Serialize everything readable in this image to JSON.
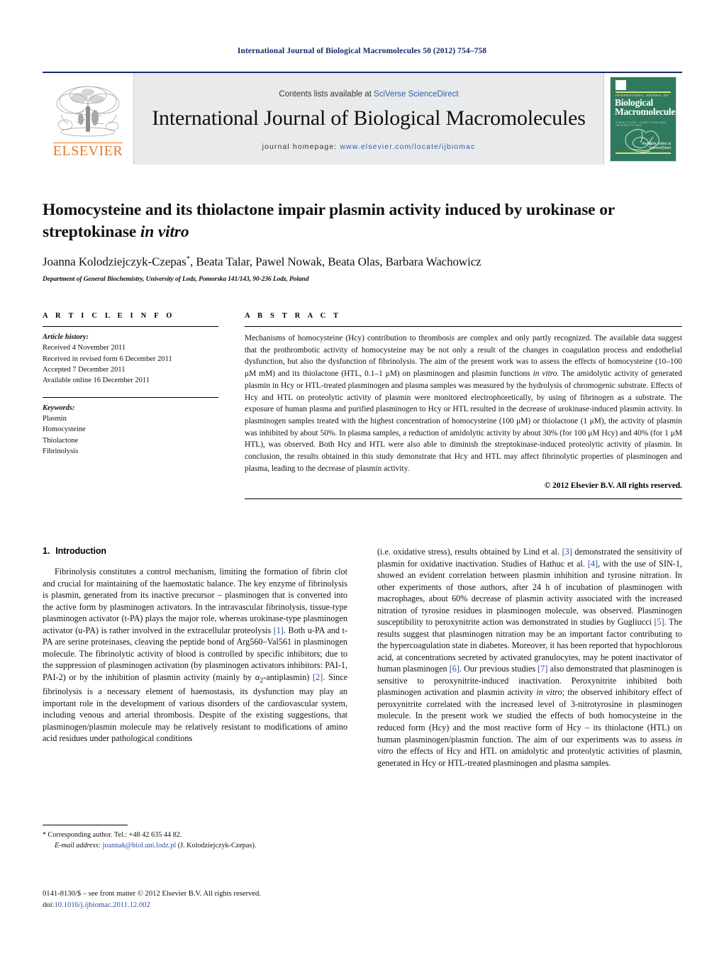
{
  "running_head": "International Journal of Biological Macromolecules 50 (2012) 754–758",
  "masthead": {
    "contents_prefix": "Contents lists available at ",
    "sciencedirect": "SciVerse ScienceDirect",
    "journal_name": "International Journal of Biological Macromolecules",
    "homepage_label": "journal homepage:",
    "homepage_url": "www.elsevier.com/locate/ijbiomac",
    "publisher_logo_text": "ELSEVIER",
    "cover": {
      "eyebrow": "INTERNATIONAL JOURNAL OF",
      "title_line1": "Biological",
      "title_line2": "Macromolecules",
      "subtitle": "STRUCTURE, FUNCTION AND INTERACTIONS",
      "footer_label": "Available online at",
      "footer_brand": "ScienceDirect"
    },
    "accent_navy": "#1a2a6c",
    "accent_orange": "#E87722",
    "band_gray": "#e9eaec",
    "cover_green": "#2f7a5e"
  },
  "article": {
    "title_part1": "Homocysteine and its thiolactone impair plasmin activity induced by urokinase or streptokinase ",
    "title_italic": "in vitro",
    "authors": "Joanna Kolodziejczyk-Czepas",
    "authors_star": "*",
    "authors_rest": ", Beata Talar, Pawel Nowak, Beata Olas, Barbara Wachowicz",
    "affiliation": "Department of General Biochemistry, University of Lodz, Pomorska 141/143, 90-236 Lodz, Poland"
  },
  "article_info": {
    "heading": "A R T I C L E   I N F O",
    "history_label": "Article history:",
    "history": [
      "Received 4 November 2011",
      "Received in revised form 6 December 2011",
      "Accepted 7 December 2011",
      "Available online 16 December 2011"
    ],
    "keywords_label": "Keywords:",
    "keywords": [
      "Plasmin",
      "Homocysteine",
      "Thiolactone",
      "Fibrinolysis"
    ]
  },
  "abstract": {
    "heading": "A B S T R A C T",
    "p1": "Mechanisms of homocysteine (Hcy) contribution to thrombosis are complex and only partly recognized. The available data suggest that the prothrombotic activity of homocysteine may be not only a result of the changes in coagulation process and endothelial dysfunction, but also the dysfunction of fibrinolysis. The aim of the present work was to assess the effects of homocysteine (10–100 μM mM) and its thiolactone (HTL, 0.1–1 μM) on plasminogen and plasmin functions ",
    "p1_italic": "in vitro",
    "p1_cont": ". The amidolytic activity of generated plasmin in Hcy or HTL-treated plasminogen and plasma samples was measured by the hydrolysis of chromogenic substrate. Effects of Hcy and HTL on proteolytic activity of plasmin were monitored electrophoretically, by using of fibrinogen as a substrate. The exposure of human plasma and purified plasminogen to Hcy or HTL resulted in the decrease of urokinase-induced plasmin activity. In plasminogen samples treated with the highest concentration of homocysteine (100 μM) or thiolactone (1 μM), the activity of plasmin was inhibited by about 50%. In plasma samples, a reduction of amidolytic activity by about 30% (for 100 μM Hcy) and 40% (for 1 μM HTL), was observed. Both Hcy and HTL were also able to diminish the streptokinase-induced proteolytic activity of plasmin. In conclusion, the results obtained in this study demonstrate that Hcy and HTL may affect fibrinolytic properties of plasminogen and plasma, leading to the decrease of plasmin activity.",
    "copyright": "© 2012 Elsevier B.V. All rights reserved."
  },
  "introduction": {
    "number": "1.",
    "title": "Introduction",
    "left_p1_a": "Fibrinolysis constitutes a control mechanism, limiting the formation of fibrin clot and crucial for maintaining of the haemostatic balance. The key enzyme of fibrinolysis is plasmin, generated from its inactive precursor – plasminogen that is converted into the active form by plasminogen activators. In the intravascular fibrinolysis, tissue-type plasminogen activator (t-PA) plays the major role, whereas urokinase-type plasminogen activator (u-PA) is rather involved in the extracellular proteolysis ",
    "ref1": "[1]",
    "left_p1_b": ". Both u-PA and t-PA are serine proteinases, cleaving the peptide bond of Arg560–Val561 in plasminogen molecule. The fibrinolytic activity of blood is controlled by specific inhibitors; due to the suppression of plasminogen activation (by plasminogen activators inhibitors: PAI-1, PAI-2) or by the inhibition of plasmin activity (mainly by α",
    "alpha_sub": "2",
    "left_p1_c": "-antiplasmin) ",
    "ref2": "[2]",
    "left_p1_d": ". Since fibrinolysis is a necessary element of haemostasis, its dysfunction may play an important role in the development of various disorders of the cardiovascular system, including venous and arterial thrombosis. Despite of the existing suggestions, that plasminogen/plasmin molecule may be relatively resistant to modifications of amino acid residues under pathological conditions",
    "right_a": "(i.e. oxidative stress), results obtained by Lind et al. ",
    "ref3": "[3]",
    "right_b": " demonstrated the sensitivity of plasmin for oxidative inactivation. Studies of Hathuc et al. ",
    "ref4": "[4]",
    "right_c": ", with the use of SIN-1, showed an evident correlation between plasmin inhibition and tyrosine nitration. In other experiments of those authors, after 24 h of incubation of plasminogen with macrophages, about 60% decrease of plasmin activity associated with the increased nitration of tyrosine residues in plasminogen molecule, was observed. Plasminogen susceptibility to peroxynitrite action was demonstrated in studies by Gugliucci ",
    "ref5": "[5]",
    "right_d": ". The results suggest that plasminogen nitration may be an important factor contributing to the hypercoagulation state in diabetes. Moreover, it has been reported that hypochlorous acid, at concentrations secreted by activated granulocytes, may be potent inactivator of human plasminogen ",
    "ref6": "[6]",
    "right_e": ". Our previous studies ",
    "ref7": "[7]",
    "right_f": " also demonstrated that plasminogen is sensitive to peroxynitrite-induced inactivation. Peroxynitrite inhibited both plasminogen activation and plasmin activity ",
    "invitro1": "in vitro",
    "right_g": "; the observed inhibitory effect of peroxynitrite correlated with the increased level of 3-nitrotyrosine in plasminogen molecule. In the present work we studied the effects of both homocysteine in the reduced form (Hcy) and the most reactive form of Hcy – its thiolactone (HTL) on human plasminogen/plasmin function. The aim of our experiments was to assess ",
    "invitro2": "in vitro",
    "right_h": " the effects of Hcy and HTL on amidolytic and proteolytic activities of plasmin, generated in Hcy or HTL-treated plasminogen and plasma samples."
  },
  "footnote": {
    "star": "*",
    "corresponding": " Corresponding author. Tel.: +48 42 635 44 82.",
    "email_label": "E-mail address:",
    "email": "joannak@biol.uni.lodz.pl",
    "email_owner": " (J. Kolodziejczyk-Czepas)."
  },
  "imprint": {
    "line1": "0141-8130/$ – see front matter © 2012 Elsevier B.V. All rights reserved.",
    "doi_label": "doi:",
    "doi": "10.1016/j.ijbiomac.2011.12.002"
  }
}
